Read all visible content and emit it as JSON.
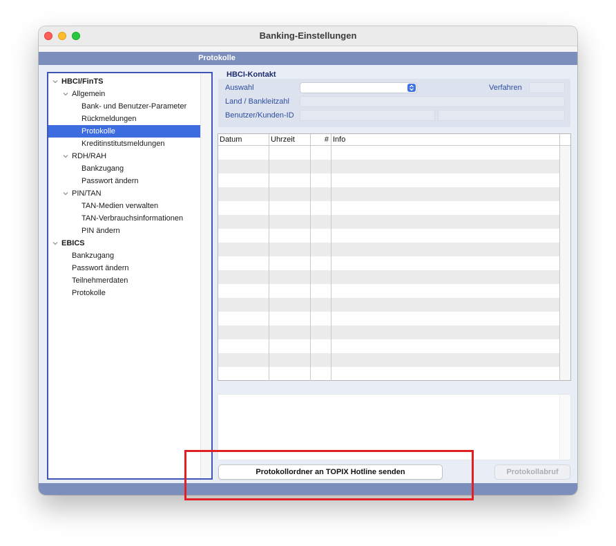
{
  "window": {
    "title": "Banking-Einstellungen"
  },
  "section": {
    "title": "Protokolle"
  },
  "tree": {
    "items": [
      {
        "label": "HBCI/FinTS",
        "level": 0,
        "bold": true,
        "expanded": true,
        "selected": false
      },
      {
        "label": "Allgemein",
        "level": 1,
        "bold": false,
        "expanded": true,
        "selected": false
      },
      {
        "label": "Bank- und Benutzer-Parameter",
        "level": 2,
        "bold": false,
        "selected": false
      },
      {
        "label": "Rückmeldungen",
        "level": 2,
        "bold": false,
        "selected": false
      },
      {
        "label": "Protokolle",
        "level": 2,
        "bold": false,
        "selected": true
      },
      {
        "label": "Kreditinstitutsmeldungen",
        "level": 2,
        "bold": false,
        "selected": false
      },
      {
        "label": "RDH/RAH",
        "level": 1,
        "bold": false,
        "expanded": true,
        "selected": false
      },
      {
        "label": "Bankzugang",
        "level": 2,
        "bold": false,
        "selected": false
      },
      {
        "label": "Passwort ändern",
        "level": 2,
        "bold": false,
        "selected": false
      },
      {
        "label": "PIN/TAN",
        "level": 1,
        "bold": false,
        "expanded": true,
        "selected": false
      },
      {
        "label": "TAN-Medien verwalten",
        "level": 2,
        "bold": false,
        "selected": false
      },
      {
        "label": "TAN-Verbrauchsinformationen",
        "level": 2,
        "bold": false,
        "selected": false
      },
      {
        "label": "PIN ändern",
        "level": 2,
        "bold": false,
        "selected": false
      },
      {
        "label": "EBICS",
        "level": 0,
        "bold": true,
        "expanded": true,
        "selected": false
      },
      {
        "label": "Bankzugang",
        "level": 1,
        "bold": false,
        "selected": false
      },
      {
        "label": "Passwort ändern",
        "level": 1,
        "bold": false,
        "selected": false
      },
      {
        "label": "Teilnehmerdaten",
        "level": 1,
        "bold": false,
        "selected": false
      },
      {
        "label": "Protokolle",
        "level": 1,
        "bold": false,
        "selected": false
      }
    ]
  },
  "contact": {
    "title": "HBCI-Kontakt",
    "auswahl_label": "Auswahl",
    "auswahl_value": "",
    "verfahren_label": "Verfahren",
    "verfahren_value": "",
    "blz_label": "Land / Bankleitzahl",
    "blz_value": "",
    "user_label": "Benutzer/Kunden-ID",
    "user_value": ""
  },
  "table": {
    "columns": [
      "Datum",
      "Uhrzeit",
      "#",
      "Info"
    ],
    "rows": []
  },
  "info_text": "",
  "buttons": {
    "send": "Protokollordner an TOPIX Hotline senden",
    "abruf": "Protokollabruf"
  },
  "colors": {
    "accent": "#3d6ce0",
    "section_bar": "#7b8ebc",
    "highlight": "#e31e24"
  }
}
